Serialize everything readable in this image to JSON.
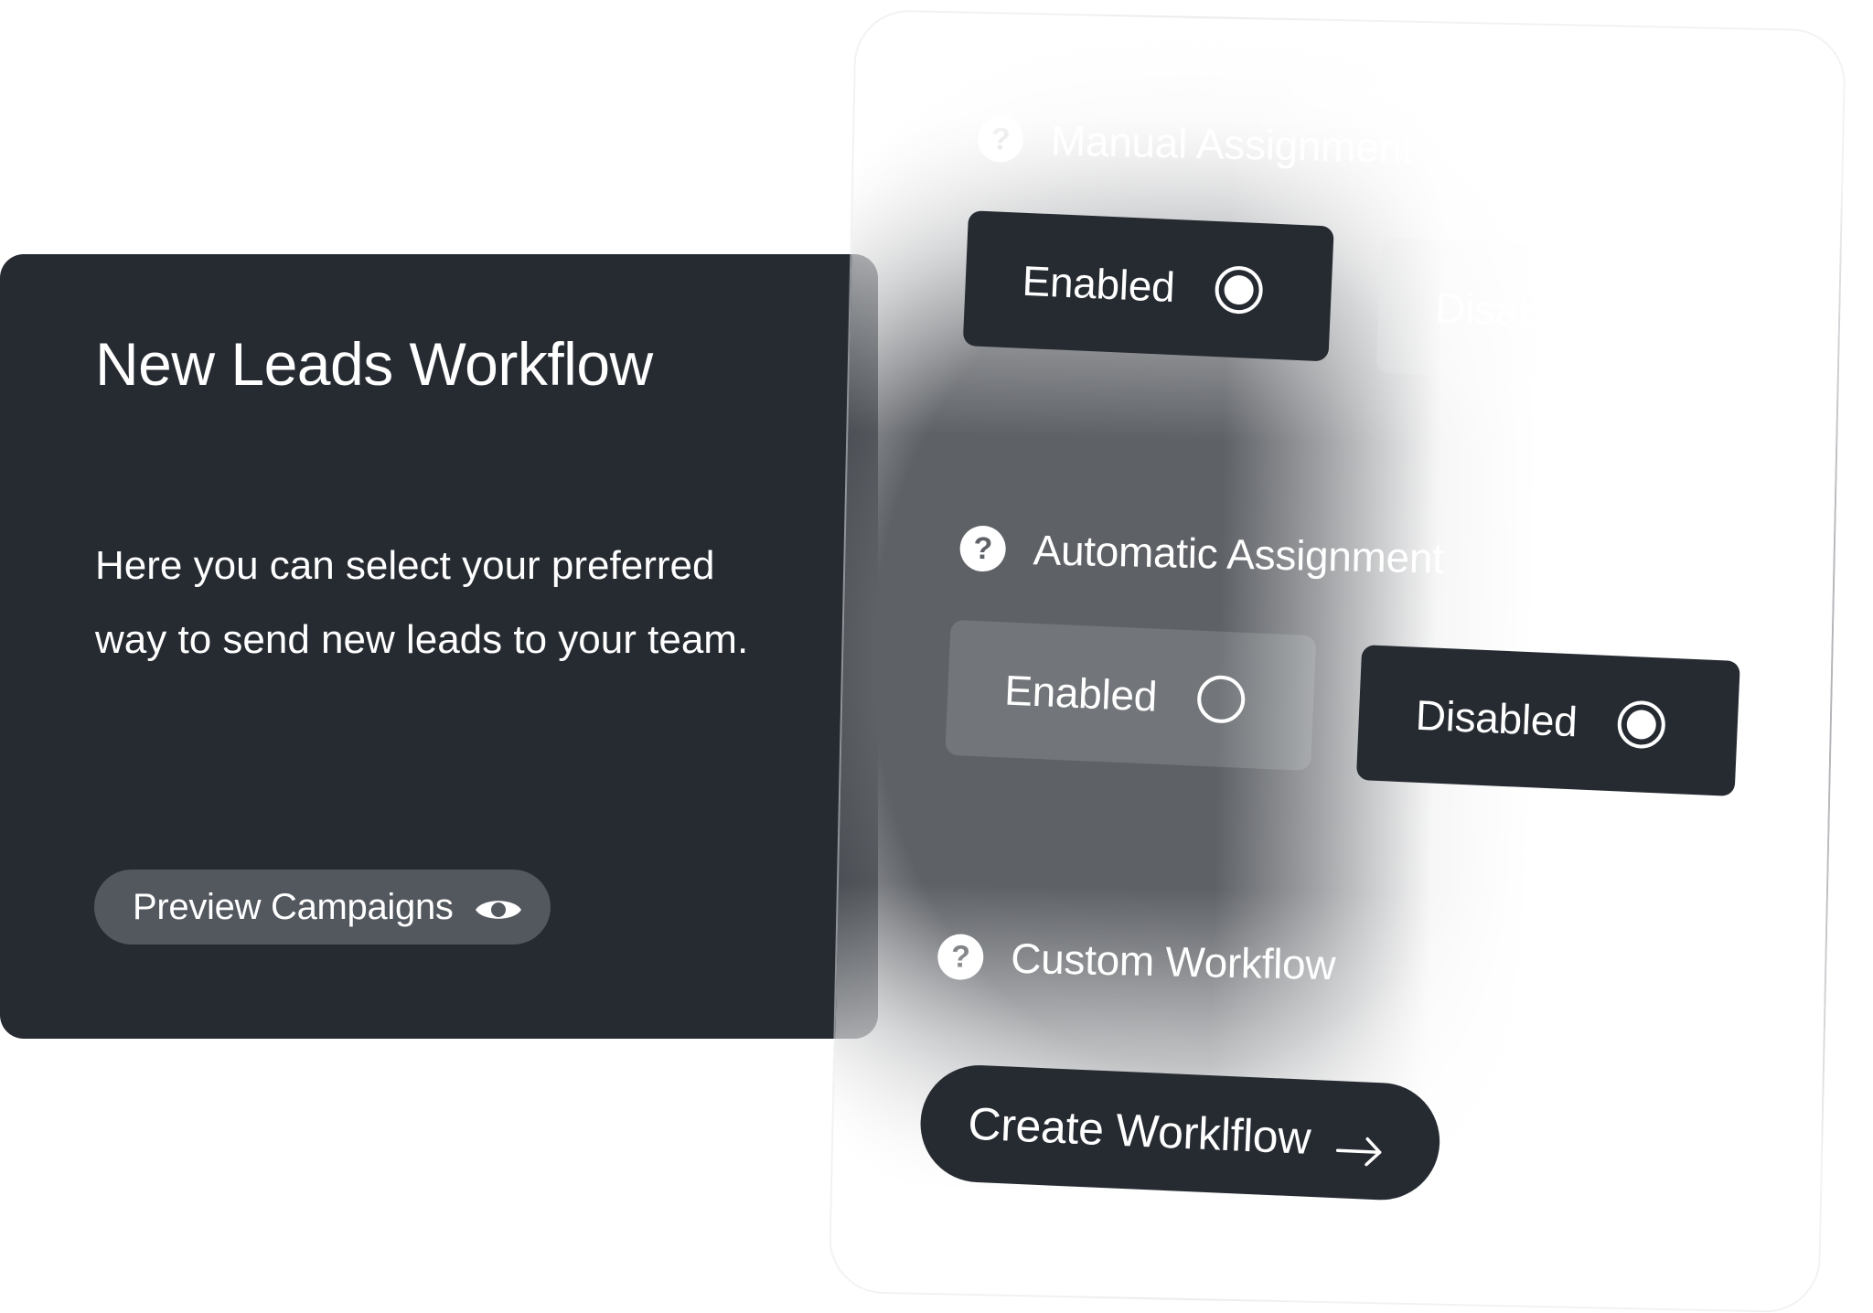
{
  "card": {
    "title": "New Leads Workflow",
    "description": "Here you can select your preferred way to send new leads to your team.",
    "preview_button": {
      "label": "Preview Campaigns",
      "icon": "eye-icon"
    }
  },
  "panel": {
    "sections": [
      {
        "title": "Manual Assignment",
        "help_icon": "question-circle-icon",
        "options": [
          {
            "label": "Enabled",
            "selected": true
          },
          {
            "label": "Disabled",
            "selected": false
          }
        ]
      },
      {
        "title": "Automatic Assignment",
        "help_icon": "question-circle-icon",
        "options": [
          {
            "label": "Enabled",
            "selected": false
          },
          {
            "label": "Disabled",
            "selected": true
          }
        ]
      },
      {
        "title": "Custom Workflow",
        "help_icon": "question-circle-icon"
      }
    ],
    "create_button": {
      "label": "Create Worklflow",
      "icon": "arrow-right-icon"
    },
    "help_glyph": "?"
  },
  "colors": {
    "dark": "#262b32",
    "panel_gray": "#5e6166",
    "unselected_option": "#72767a",
    "preview_button": "#53575e",
    "text": "#ffffff"
  }
}
